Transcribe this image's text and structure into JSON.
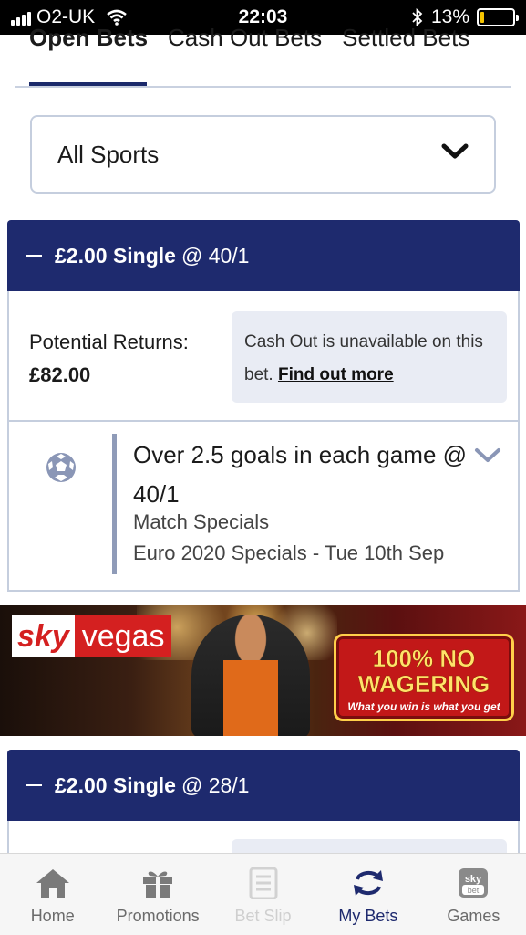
{
  "status_bar": {
    "carrier": "O2-UK",
    "time": "22:03",
    "battery_percent": "13%",
    "battery_level": 0.13
  },
  "tabs": [
    "Open Bets",
    "Cash Out Bets",
    "Settled Bets"
  ],
  "active_tab": "Open Bets",
  "filter": {
    "selected": "All Sports"
  },
  "bets": [
    {
      "stake_type": "£2.00 Single",
      "odds": "@ 40/1",
      "returns_label": "Potential Returns:",
      "returns_value": "£82.00",
      "cashout_text": "Cash Out is unavailable on this bet.",
      "cashout_link": "Find out more",
      "selection": {
        "title": "Over 2.5 goals in each game @ 40/1",
        "market": "Match Specials",
        "event": "Euro 2020 Specials - Tue 10th Sep"
      }
    },
    {
      "stake_type": "£2.00 Single",
      "odds": "@ 28/1"
    }
  ],
  "banner": {
    "brand_sky": "sky",
    "brand_vegas": "vegas",
    "promo_headline": "100% NO WAGERING",
    "promo_tagline": "What you win is what you get"
  },
  "bottom_nav": [
    {
      "label": "Home",
      "icon": "home-icon"
    },
    {
      "label": "Promotions",
      "icon": "gift-icon"
    },
    {
      "label": "Bet Slip",
      "icon": "betslip-icon"
    },
    {
      "label": "My Bets",
      "icon": "refresh-arrows-icon"
    },
    {
      "label": "Games",
      "icon": "skybet-icon"
    }
  ],
  "colors": {
    "navy": "#1e2a6e",
    "border": "#c5cede",
    "info_bg": "#e9ecf4",
    "accent_red": "#d42020"
  }
}
